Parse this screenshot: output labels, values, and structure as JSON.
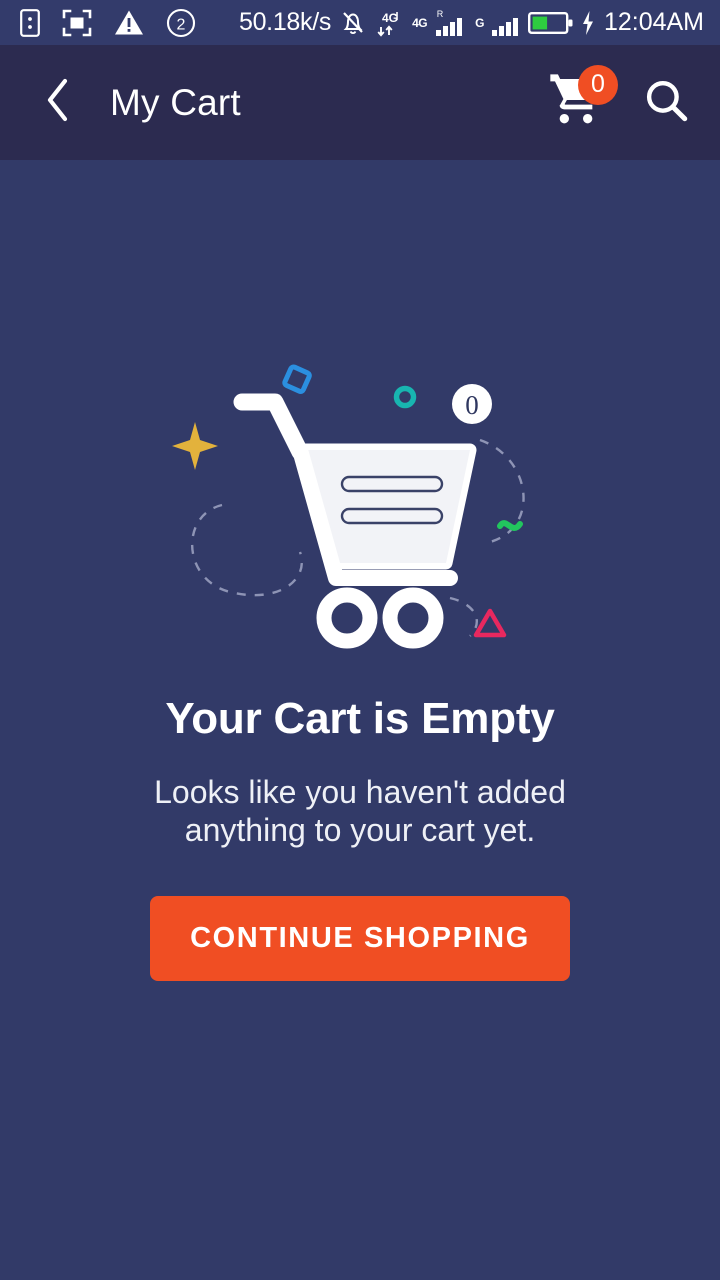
{
  "statusbar": {
    "icons_left": [
      "sim-card-icon",
      "screenshot-frame-icon",
      "warning-triangle-icon",
      "notification-count-icon"
    ],
    "notification_count": "2",
    "network_speed": "50.18k/s",
    "silent_icon": "bell-muted-icon",
    "data_transfer_label": "4G",
    "sim1_label": "4G",
    "sim1_roaming": "R",
    "sim2_label": "G",
    "battery_icon": "battery-charging-icon",
    "battery_level_percent": 42,
    "time": "12:04AM"
  },
  "appbar": {
    "back_icon": "chevron-left-icon",
    "title": "My Cart",
    "cart_icon": "shopping-cart-icon",
    "cart_badge_count": "0",
    "search_icon": "search-icon"
  },
  "empty_state": {
    "illustration": "empty-shopping-cart-illustration",
    "badge_number": "0",
    "title": "Your Cart is Empty",
    "subtitle": "Looks like you haven't added anything to your cart yet.",
    "cta_label": "CONTINUE SHOPPING"
  },
  "colors": {
    "status_bar_bg": "#333b6b",
    "app_bar_bg": "#2c2b50",
    "page_bg": "#323a68",
    "accent_orange": "#f04e23",
    "text_primary": "#ffffff",
    "deco_blue": "#2b8fe0",
    "deco_teal": "#18b5b0",
    "deco_yellow": "#e3b23c",
    "deco_green": "#22c55e",
    "deco_pink": "#e8285f",
    "battery_green": "#2ecc40"
  }
}
